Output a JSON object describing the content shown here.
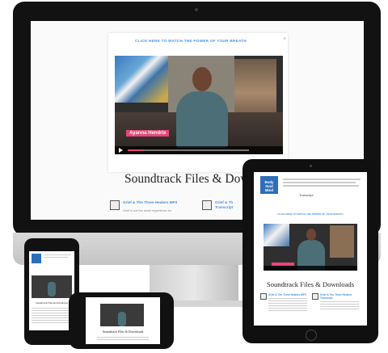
{
  "monitor": {
    "banner_text": "CLICK HERE TO WATCH THE POWER OF YOUR BREATH",
    "banner_close": "×",
    "video_name_tag": "Ayanna Hendrix",
    "section_heading": "Soundtrack Files & Downl",
    "files": [
      {
        "title": "Grief & The Three Healers MP3",
        "desc": "Grief is not the same experience for"
      },
      {
        "title": "Grief & Th",
        "desc": "Transcript"
      }
    ]
  },
  "tablet": {
    "logo_text": "Body Soul Mind",
    "heading_text": "Transcript",
    "banner_text": "CLICK HERE TO WATCH THE POWER OF YOUR BREATH",
    "section_heading": "Soundtrack Files & Downloads",
    "files": [
      {
        "title": "Grief & The Three Healers MP3"
      },
      {
        "title": "Grief & The Three Healers Transcript"
      }
    ]
  },
  "phone_vertical": {
    "section_heading": "Soundtrack Files & Downloads"
  },
  "phone_horizontal": {
    "section_heading": "Soundtrack Files & Downloads"
  },
  "colors": {
    "accent_blue": "#4a90e2",
    "name_tag_pink": "#e8467a",
    "logo_blue": "#2d6dba"
  }
}
